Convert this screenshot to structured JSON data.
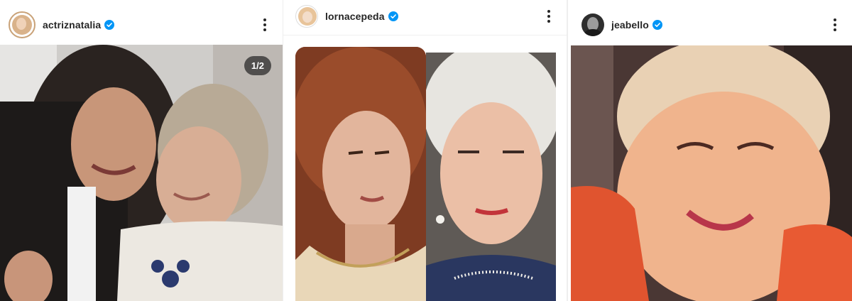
{
  "posts": [
    {
      "username": "actriznatalia",
      "verified": true,
      "image_counter": "1/2"
    },
    {
      "username": "lornacepeda",
      "verified": true
    },
    {
      "username": "jeabello",
      "verified": true
    }
  ],
  "colors": {
    "verified_blue": "#0095f6",
    "text": "#262626",
    "counter_bg": "#262626"
  },
  "icons": {
    "verified": "verified-badge-icon",
    "more": "more-options-icon"
  }
}
